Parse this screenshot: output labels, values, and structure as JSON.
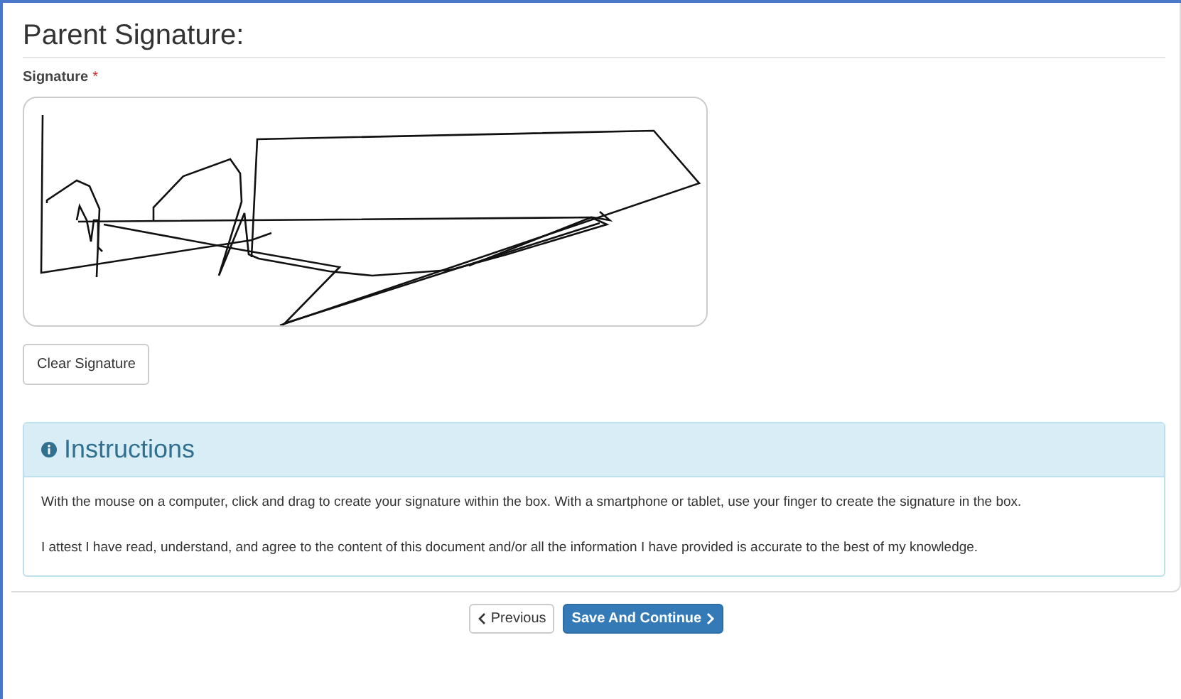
{
  "section_title": "Parent Signature:",
  "signature": {
    "label": "Signature",
    "required_mark": "*"
  },
  "clear_button": "Clear Signature",
  "instructions": {
    "title": "Instructions",
    "paragraphs": [
      "With the mouse on a computer, click and drag to create your signature within the box. With a smartphone or tablet, use your finger to create the signature in the box.",
      "I attest I have read, understand, and agree to the content of this document and/or all the information I have provided is accurate to the best of my knowledge."
    ]
  },
  "nav": {
    "previous": "Previous",
    "next": "Save And Continue"
  }
}
